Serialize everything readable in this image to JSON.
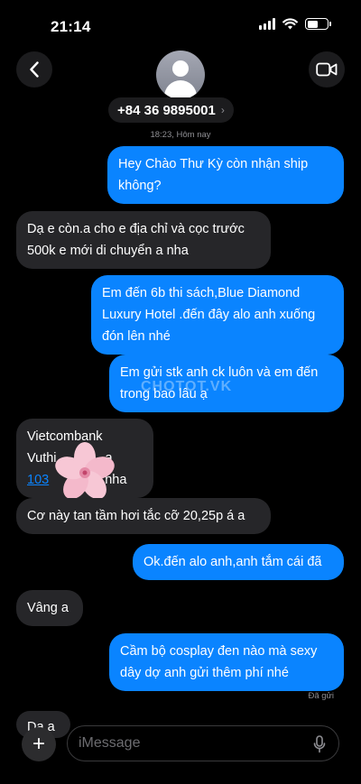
{
  "status_bar": {
    "time": "21:14",
    "battery_level": 0.55
  },
  "header": {
    "back_icon": "chevron-left-icon",
    "video_icon": "video-camera-icon",
    "avatar_icon": "person-silhouette",
    "contact_name": "+84 36 9895001",
    "contact_chevron": "›"
  },
  "timestamp": "18:23, Hôm nay",
  "messages": [
    {
      "side": "sent",
      "text": "Hey Chào Thư Kỳ còn nhận ship\nkhông?"
    },
    {
      "side": "received",
      "text": "Dạ e còn.a cho e địa chỉ và cọc trước\n500k e mới di chuyển a nha"
    },
    {
      "side": "sent",
      "text": "Em đến 6b thi sách,Blue Diamond\nLuxury Hotel .đến đây alo anh xuống\nđón lên nhé"
    },
    {
      "side": "sent",
      "text": "Em gửi stk anh ck luôn và em đến\ntrong bao lâu ạ"
    },
    {
      "side": "received",
      "line1": "Vietcombank",
      "line2": "Vuthi",
      "line2_end": "a",
      "link": "103",
      "line3_end": "nha"
    },
    {
      "side": "received",
      "text": "Cơ này tan tầm hơi tắc cỡ 20,25p á a"
    },
    {
      "side": "sent",
      "text": "Ok.đến alo anh,anh tắm cái đã"
    },
    {
      "side": "received",
      "text": "Vâng a"
    },
    {
      "side": "sent",
      "text": "Cầm bộ cosplay đen nào mà sexy\ndây dợ anh gửi thêm phí nhé"
    },
    {
      "side": "received",
      "text": "Dạ a"
    }
  ],
  "read_receipt": "Đã gửi",
  "watermark": "CHOTOT.VK",
  "input": {
    "placeholder": "iMessage",
    "value": "",
    "plus_label": "+"
  },
  "colors": {
    "sent_bubble": "#0a84ff",
    "received_bubble": "#262629",
    "background": "#000000",
    "link": "#0a84ff"
  }
}
